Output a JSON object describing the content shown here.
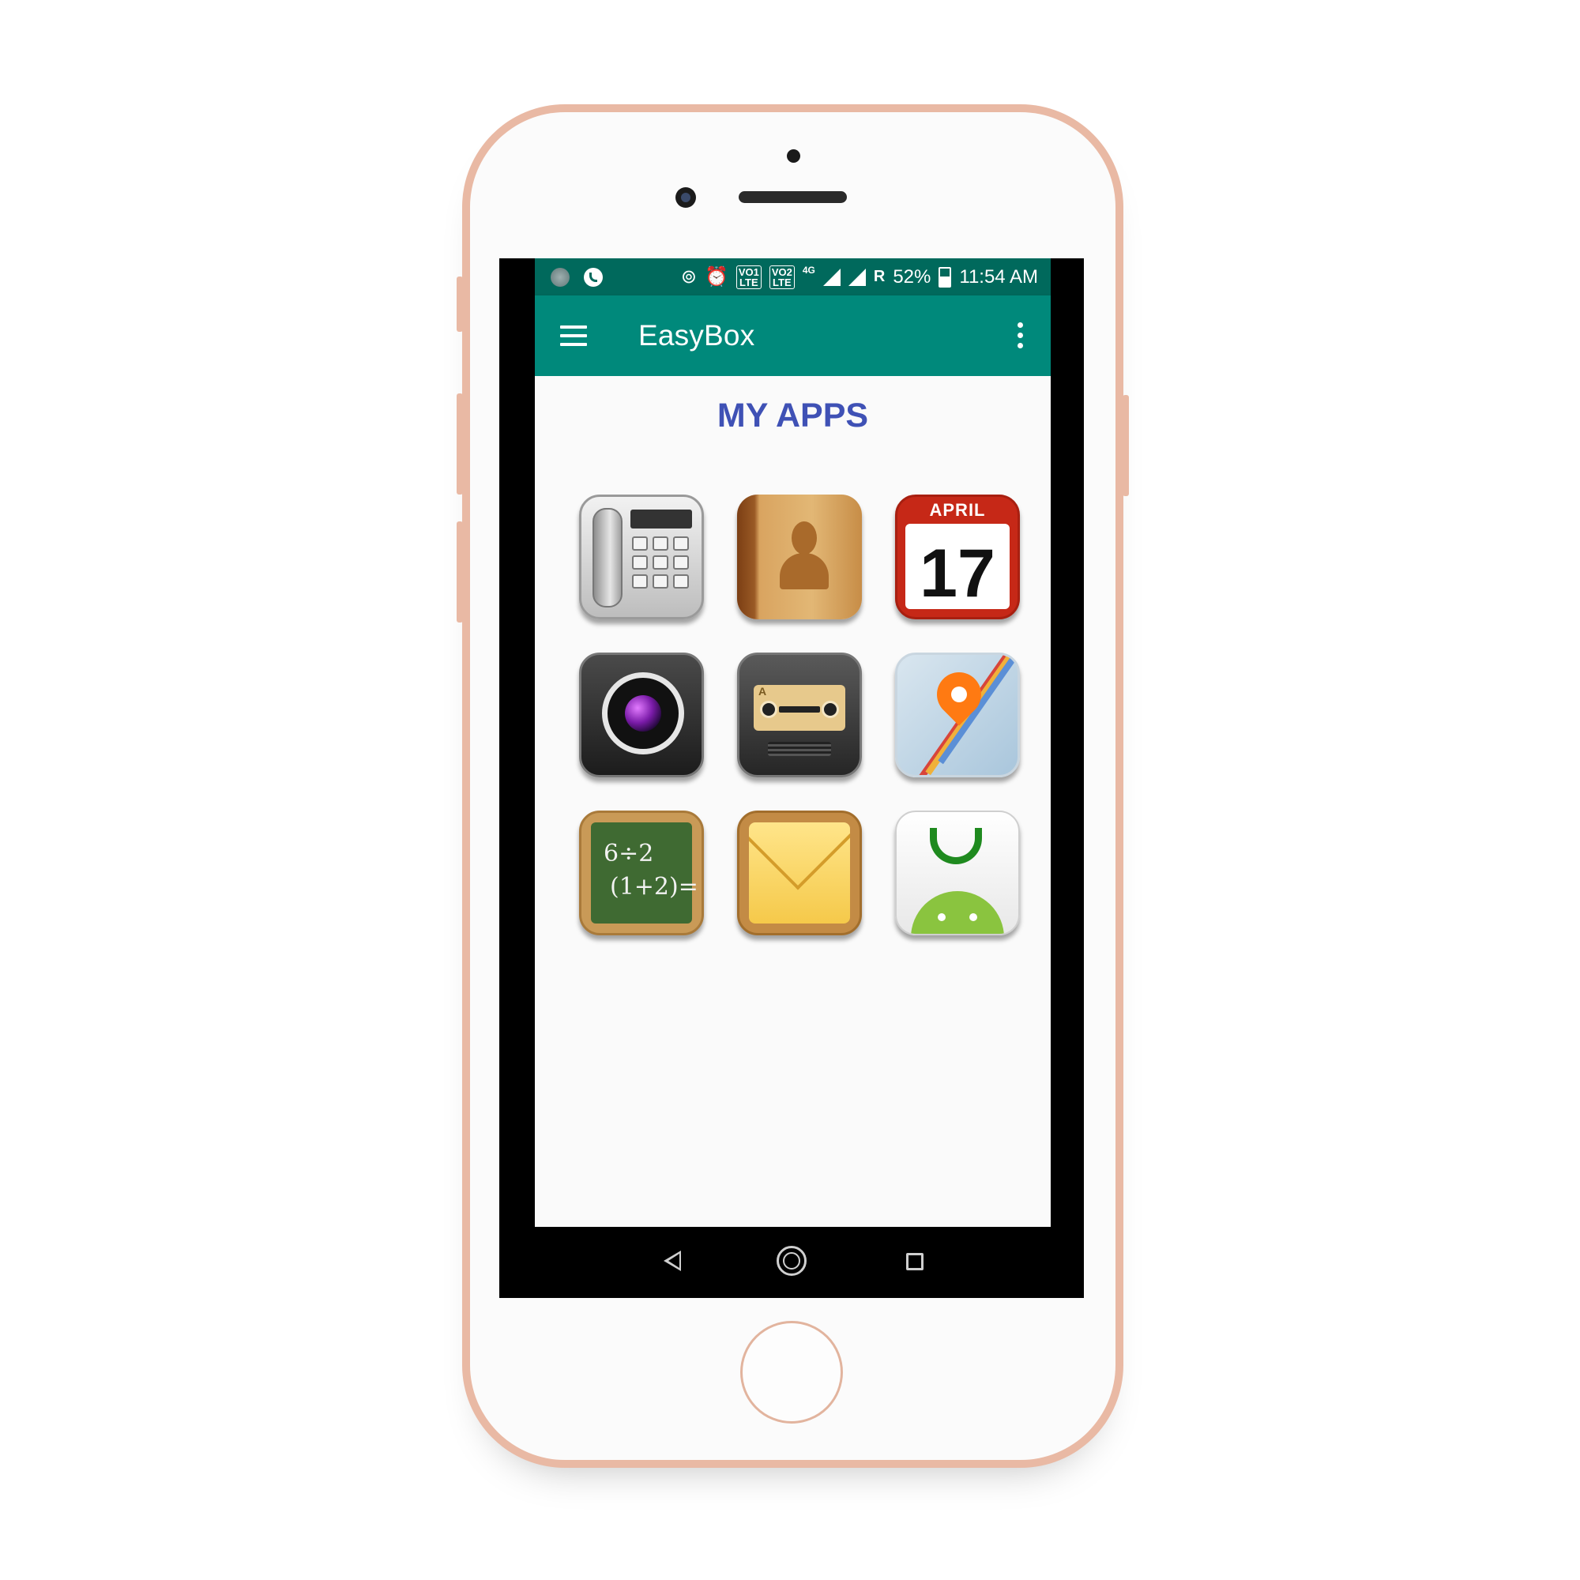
{
  "status_bar": {
    "carrier_1": "VO1",
    "carrier_1_sub": "LTE",
    "carrier_2": "VO2",
    "carrier_2_sub": "LTE",
    "network": "4G",
    "roaming": "R",
    "battery": "52%",
    "battery_level": 0.52,
    "time": "11:54 AM",
    "icons": [
      "app-notification-icon",
      "whatsapp-call-icon",
      "hotspot-icon",
      "alarm-icon",
      "signal-icon",
      "battery-icon"
    ]
  },
  "app_bar": {
    "title": "EasyBox",
    "color": "#00897b",
    "status_color": "#00695c",
    "icons": [
      "menu-icon",
      "more-options-icon"
    ]
  },
  "content": {
    "section_title": "MY APPS",
    "title_color": "#3f51b5",
    "apps": [
      {
        "icon": "phone-dialer-icon"
      },
      {
        "icon": "contacts-icon"
      },
      {
        "icon": "calendar-icon",
        "month": "APRIL",
        "day": "17"
      },
      {
        "icon": "camera-icon"
      },
      {
        "icon": "voice-recorder-icon",
        "label": "A"
      },
      {
        "icon": "maps-icon"
      },
      {
        "icon": "calculator-icon",
        "line1": "6÷2",
        "line2": "(1+2)="
      },
      {
        "icon": "mail-icon"
      },
      {
        "icon": "play-store-icon"
      }
    ]
  },
  "nav_bar": {
    "icons": [
      "back-icon",
      "home-icon",
      "recent-apps-icon"
    ]
  }
}
